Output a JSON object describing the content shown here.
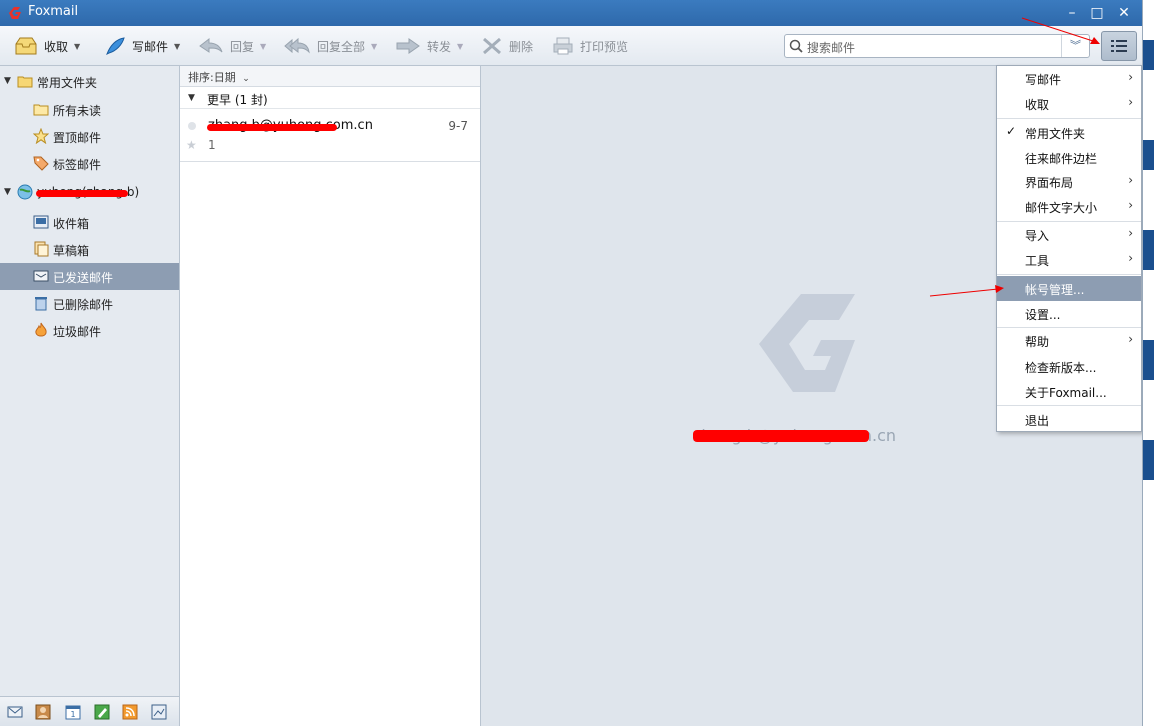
{
  "app": {
    "title": "Foxmail"
  },
  "toolbar": {
    "receive": "收取",
    "compose": "写邮件",
    "reply": "回复",
    "reply_all": "回复全部",
    "forward": "转发",
    "delete": "删除",
    "print_preview": "打印预览",
    "search_placeholder": "搜索邮件"
  },
  "folders": {
    "common_group": "常用文件夹",
    "items_common": [
      "所有未读",
      "置顶邮件",
      "标签邮件"
    ],
    "account": "yuhong(zhang.b)",
    "items_account": [
      "收件箱",
      "草稿箱",
      "已发送邮件",
      "已删除邮件",
      "垃圾邮件"
    ],
    "selected": "已发送邮件"
  },
  "maillist": {
    "sort_label": "排序:日期",
    "group_label": "更早 (1 封)",
    "mail": {
      "from": "zhang.b@yuhong.com.cn",
      "date": "9-7",
      "count": "1"
    }
  },
  "preview": {
    "address": "zhang.b@yuhong.com.cn"
  },
  "menu": {
    "items": [
      {
        "label": "写邮件",
        "submenu": true
      },
      {
        "label": "收取",
        "submenu": true
      },
      {
        "label": "常用文件夹",
        "checked": true
      },
      {
        "label": "往来邮件边栏"
      },
      {
        "label": "界面布局",
        "submenu": true
      },
      {
        "label": "邮件文字大小",
        "submenu": true
      },
      {
        "label": "导入",
        "submenu": true
      },
      {
        "label": "工具",
        "submenu": true
      },
      {
        "label": "帐号管理...",
        "highlighted": true
      },
      {
        "label": "设置..."
      },
      {
        "label": "帮助",
        "submenu": true
      },
      {
        "label": "检查新版本..."
      },
      {
        "label": "关于Foxmail..."
      },
      {
        "label": "退出"
      }
    ]
  },
  "colors": {
    "accent": "#2e69ab",
    "selection": "#8d9db2",
    "annotation": "#e00000"
  }
}
